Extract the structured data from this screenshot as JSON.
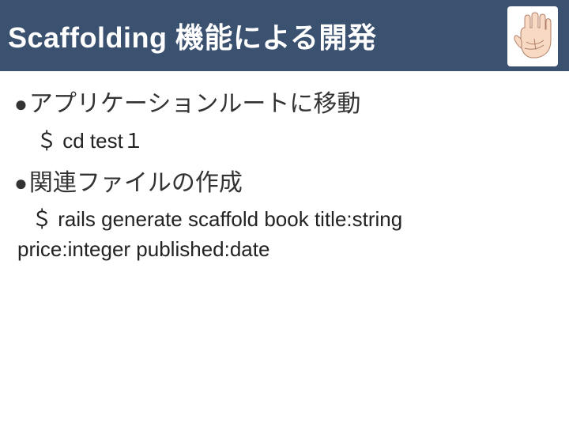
{
  "header": {
    "title": "Scaffolding 機能による開発"
  },
  "bullets": [
    {
      "label": "アプリケーションルートに移動",
      "command": "＄ cd test１"
    },
    {
      "label": "関連ファイルの作成",
      "command_line1": "＄ rails generate scaffold book title:string",
      "command_line2": "price:integer published:date"
    }
  ],
  "icons": {
    "hand": "hand-icon"
  }
}
